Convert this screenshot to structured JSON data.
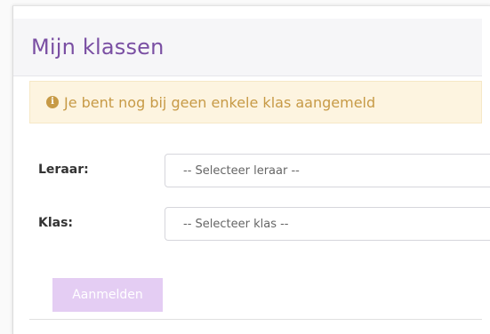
{
  "panel": {
    "title": "Mijn klassen"
  },
  "alert": {
    "icon": "info-icon",
    "icon_glyph": "i",
    "text": "Je bent nog bij geen enkele klas aangemeld",
    "color": "#c79a46",
    "background": "#fdf4e0"
  },
  "form": {
    "leraar": {
      "label": "Leraar:",
      "selected": "-- Selecteer leraar --"
    },
    "klas": {
      "label": "Klas:",
      "selected": "-- Selecteer klas --"
    },
    "submit_label": "Aanmelden"
  },
  "colors": {
    "accent": "#7a4fa3",
    "button_disabled": "#e4cdf3"
  }
}
